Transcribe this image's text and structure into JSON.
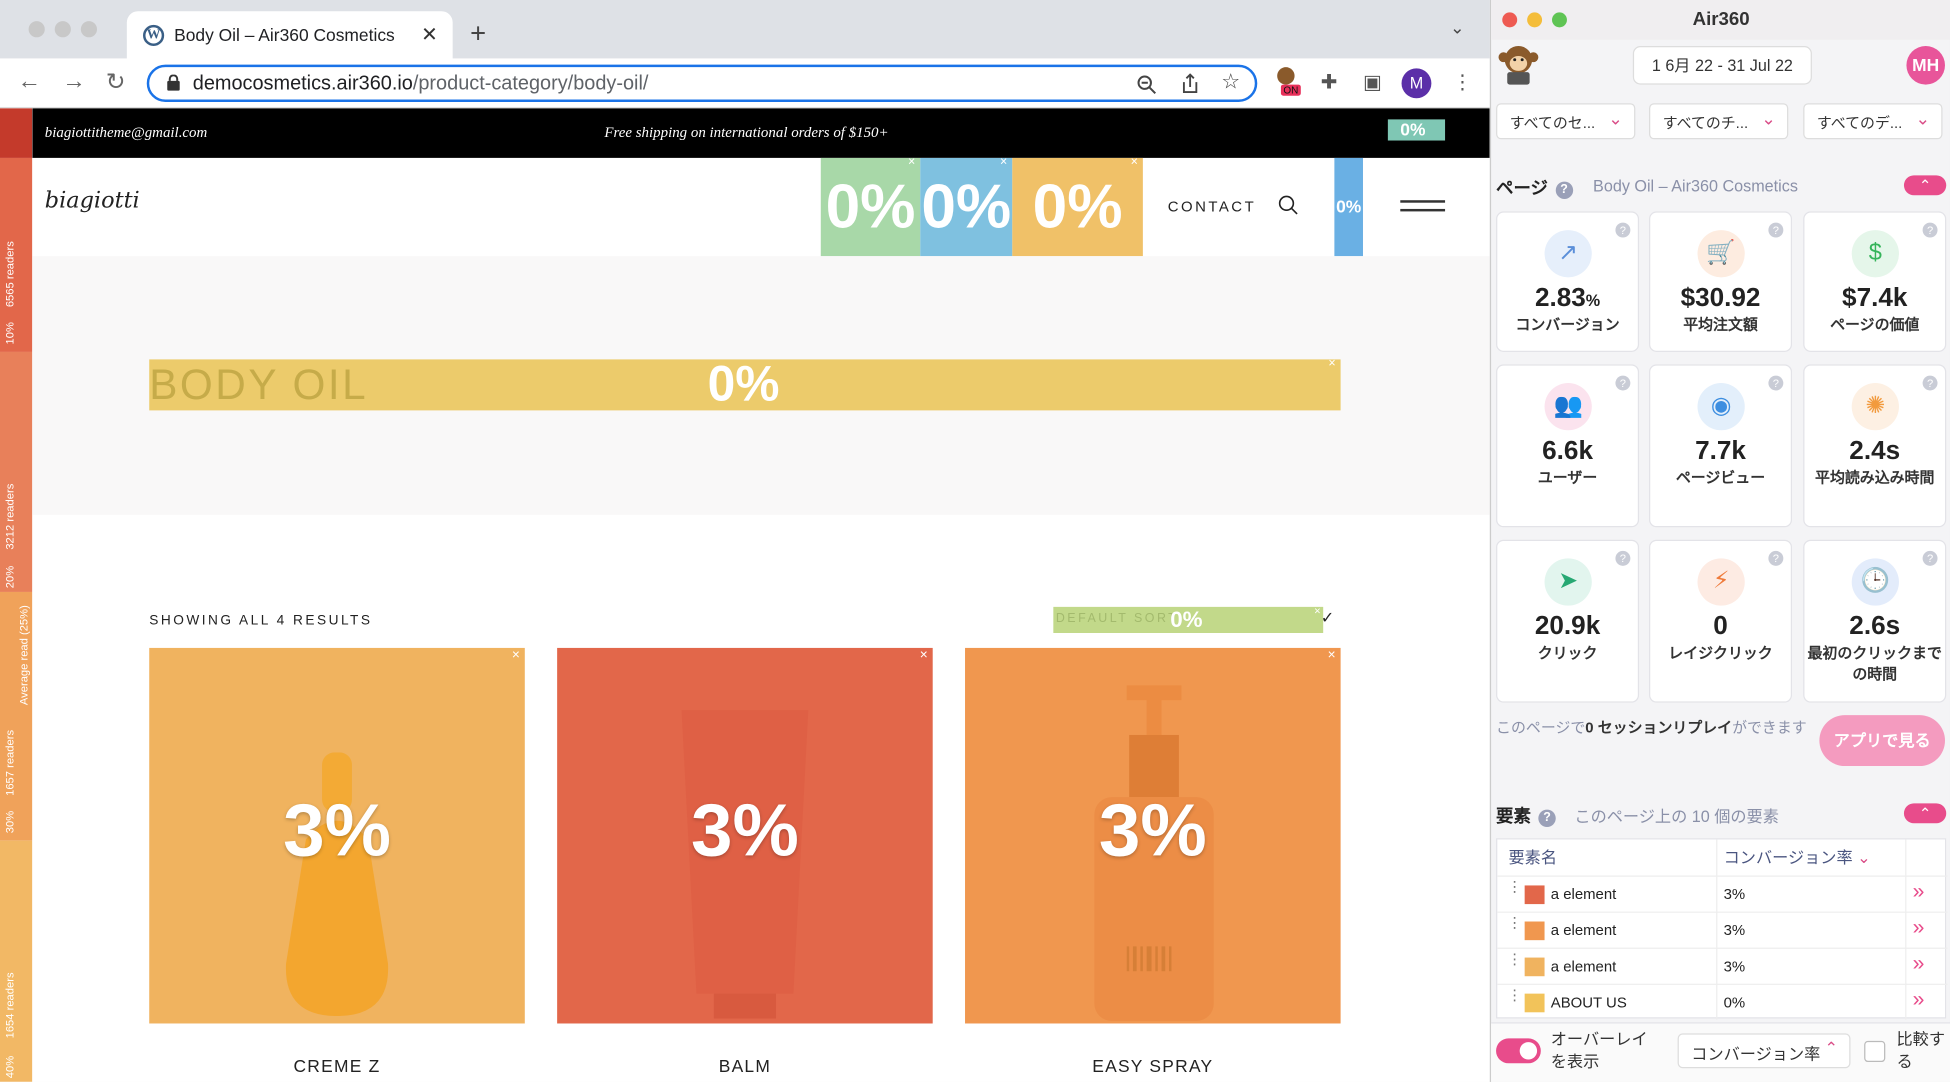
{
  "browser": {
    "tab_title": "Body Oil – Air360 Cosmetics",
    "tab_favicon": "wordpress-icon",
    "new_tab_label": "+",
    "url_domain": "democosmetics.air360.io",
    "url_path": "/product-category/body-oil/",
    "profile_initial": "M",
    "extension_badge": "ON"
  },
  "site": {
    "topbar_email": "biagiottitheme@gmail.com",
    "topbar_shipping": "Free shipping on international orders of $150+",
    "topbar_overlay": "0%",
    "logo_text": "biagiotti",
    "nav_overlays": [
      "0%",
      "0%",
      "0%"
    ],
    "nav_contact": "CONTACT",
    "nav_side_overlay": "0%",
    "hero_title": "BODY OIL",
    "hero_overlay": "0%",
    "results_text": "SHOWING ALL 4 RESULTS",
    "sort_label": "DEFAULT SORT",
    "sort_overlay": "0%",
    "products": [
      {
        "name": "CREME Z",
        "overlay": "3%",
        "color": "#f0b35f"
      },
      {
        "name": "BALM",
        "overlay": "3%",
        "color": "#e2674a"
      },
      {
        "name": "EASY SPRAY",
        "overlay": "3%",
        "color": "#f0974f"
      }
    ]
  },
  "ruler": [
    {
      "readers": "6565 readers",
      "pct": "10%"
    },
    {
      "readers": "3212 readers",
      "pct": "20%"
    },
    {
      "readers": "1657 readers",
      "pct": "30%"
    },
    {
      "readers": "1654 readers",
      "pct": "40%"
    }
  ],
  "ruler_average": "Average read (25%)",
  "panel": {
    "title": "Air360",
    "date_range": "1 6月 22 - 31 Jul 22",
    "user_initials": "MH",
    "filters": [
      "すべてのセ...",
      "すべてのチ...",
      "すべてのデ..."
    ],
    "page_section": "ページ",
    "page_name": "Body Oil – Air360 Cosmetics",
    "metrics": [
      {
        "icon": "trend-up-icon",
        "value": "2.83",
        "unit": "%",
        "label": "コンバージョン"
      },
      {
        "icon": "cart-icon",
        "value": "$30.92",
        "unit": "",
        "label": "平均注文額"
      },
      {
        "icon": "dollar-icon",
        "value": "$7.4k",
        "unit": "",
        "label": "ページの価値"
      },
      {
        "icon": "users-icon",
        "value": "6.6k",
        "unit": "",
        "label": "ユーザー"
      },
      {
        "icon": "eye-icon",
        "value": "7.7k",
        "unit": "",
        "label": "ページビュー"
      },
      {
        "icon": "spinner-icon",
        "value": "2.4s",
        "unit": "",
        "label": "平均読み込み時間"
      },
      {
        "icon": "cursor-icon",
        "value": "20.9k",
        "unit": "",
        "label": "クリック"
      },
      {
        "icon": "bolt-icon",
        "value": "0",
        "unit": "",
        "label": "レイジクリック"
      },
      {
        "icon": "clock-icon",
        "value": "2.6s",
        "unit": "",
        "label": "最初のクリックまでの時間"
      }
    ],
    "replay_prefix": "このページで",
    "replay_bold": "0 セッションリプレイ",
    "replay_suffix": "ができます",
    "app_button": "アプリで見る",
    "elements_section": "要素",
    "elements_sub": "このページ上の 10 個の要素",
    "col_name": "要素名",
    "col_metric": "コンバージョン率",
    "elements": [
      {
        "name": "a element",
        "value": "3%",
        "color": "#e2674a"
      },
      {
        "name": "a element",
        "value": "3%",
        "color": "#f0974f"
      },
      {
        "name": "a element",
        "value": "3%",
        "color": "#f0b35f"
      },
      {
        "name": "ABOUT US",
        "value": "0%",
        "color": "#f2c35a"
      }
    ],
    "overlay_label": "オーバーレイを表示",
    "metric_select": "コンバージョン率",
    "compare_label": "比較する"
  }
}
